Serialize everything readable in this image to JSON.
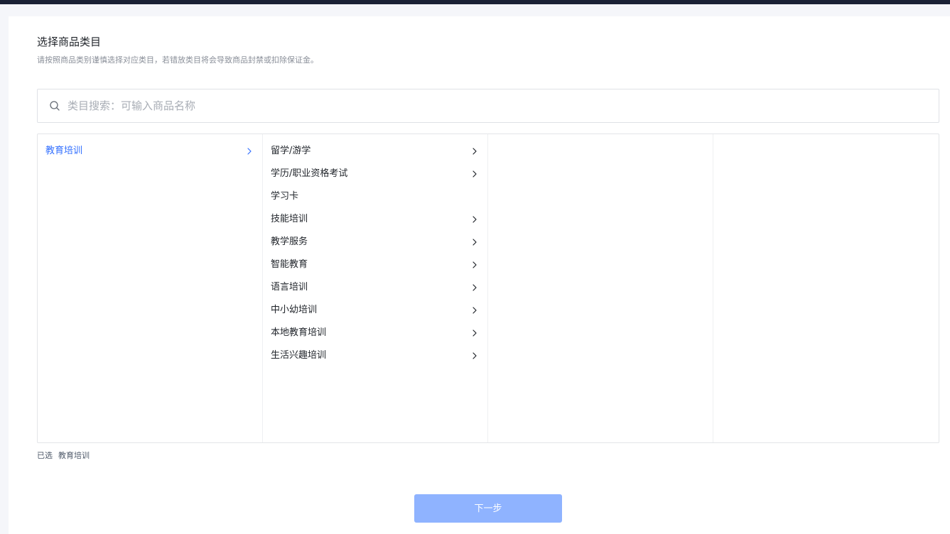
{
  "header": {
    "title": "选择商品类目",
    "subtitle": "请按照商品类别谨慎选择对应类目，若错放类目将会导致商品封禁或扣除保证金。"
  },
  "search": {
    "icon": "search-icon",
    "placeholder": "类目搜索：可输入商品名称",
    "value": ""
  },
  "columns": {
    "level1": [
      {
        "label": "教育培训",
        "has_children": true,
        "active": true
      }
    ],
    "level2": [
      {
        "label": "留学/游学",
        "has_children": true
      },
      {
        "label": "学历/职业资格考试",
        "has_children": true
      },
      {
        "label": "学习卡",
        "has_children": false
      },
      {
        "label": "技能培训",
        "has_children": true
      },
      {
        "label": "教学服务",
        "has_children": true
      },
      {
        "label": "智能教育",
        "has_children": true
      },
      {
        "label": "语言培训",
        "has_children": true
      },
      {
        "label": "中小幼培训",
        "has_children": true
      },
      {
        "label": "本地教育培训",
        "has_children": true
      },
      {
        "label": "生活兴趣培训",
        "has_children": true
      }
    ],
    "level3": [],
    "level4": []
  },
  "selection": {
    "label": "已选",
    "value": "教育培训"
  },
  "actions": {
    "next_label": "下一步"
  },
  "colors": {
    "accent": "#3370ff",
    "button_disabled": "#8fb3ff",
    "topbar": "#1b2135"
  }
}
